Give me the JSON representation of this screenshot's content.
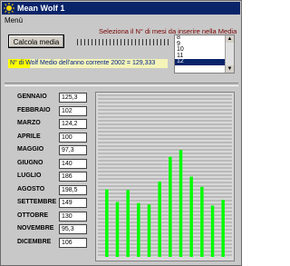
{
  "window": {
    "title": "Mean Wolf 1"
  },
  "menu": {
    "label": "Menù"
  },
  "button": {
    "label": "Calcola media"
  },
  "selector": {
    "label": "Seleziona il N° di mesi da inserire nella Media",
    "options": [
      "8",
      "9",
      "10",
      "11",
      "12"
    ],
    "selected": "12"
  },
  "info": {
    "text": "N° di Wolf Medio dell'anno corrente 2002 = 129,333"
  },
  "months": [
    {
      "name": "GENNAIO",
      "value": "125,3"
    },
    {
      "name": "FEBBRAIO",
      "value": "102"
    },
    {
      "name": "MARZO",
      "value": "124,2"
    },
    {
      "name": "APRILE",
      "value": "100"
    },
    {
      "name": "MAGGIO",
      "value": "97,3"
    },
    {
      "name": "GIUGNO",
      "value": "140"
    },
    {
      "name": "LUGLIO",
      "value": "186"
    },
    {
      "name": "AGOSTO",
      "value": "198,5"
    },
    {
      "name": "SETTEMBRE",
      "value": "149"
    },
    {
      "name": "OTTOBRE",
      "value": "130"
    },
    {
      "name": "NOVEMBRE",
      "value": "95,3"
    },
    {
      "name": "DICEMBRE",
      "value": "106"
    }
  ],
  "chart_data": {
    "type": "bar",
    "categories": [
      "GENNAIO",
      "FEBBRAIO",
      "MARZO",
      "APRILE",
      "MAGGIO",
      "GIUGNO",
      "LUGLIO",
      "AGOSTO",
      "SETTEMBRE",
      "OTTOBRE",
      "NOVEMBRE",
      "DICEMBRE"
    ],
    "values": [
      125.3,
      102,
      124.2,
      100,
      97.3,
      140,
      186,
      198.5,
      149,
      130,
      95.3,
      106
    ],
    "ylim": [
      0,
      300
    ],
    "grid": true,
    "bar_color": "#00ff00",
    "background": "#d8d8d8"
  },
  "colors": {
    "titlebar": "#0a246a",
    "info_bg": "#f4f4b8",
    "info_highlight": "#ffff00",
    "selector_text": "#7a0000"
  }
}
